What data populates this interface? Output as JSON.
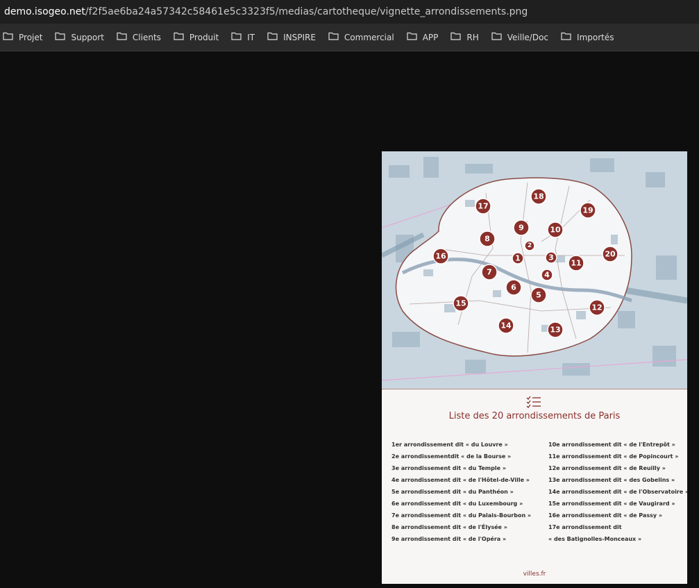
{
  "address_bar": {
    "host": "demo.isogeo.net",
    "path": "/f2f5ae6ba24a57342c58461e5c3323f5/medias/cartotheque/vignette_arrondissements.png"
  },
  "bookmarks": [
    "Projet",
    "Support",
    "Clients",
    "Produit",
    "IT",
    "INSPIRE",
    "Commercial",
    "APP",
    "RH",
    "Veille/Doc",
    "Importés"
  ],
  "image": {
    "title": "Liste des 20 arrondissements de Paris",
    "footer": "villes.fr",
    "map_markers": [
      "1",
      "2",
      "3",
      "4",
      "5",
      "6",
      "7",
      "8",
      "9",
      "10",
      "11",
      "12",
      "13",
      "14",
      "15",
      "16",
      "17",
      "18",
      "19",
      "20"
    ],
    "list_left": [
      "1er arrondissement dit « du Louvre »",
      "2e arrondissementdit « de la Bourse »",
      "3e arrondissement dit « du Temple »",
      "4e arrondissement dit « de l'Hôtel-de-Ville »",
      "5e arrondissement dit « du Panthéon »",
      "6e arrondissement dit « du Luxembourg »",
      "7e arrondissement dit « du Palais-Bourbon »",
      "8e arrondissement dit « de l'Élysée »",
      "9e arrondissement dit « de l'Opéra »"
    ],
    "list_right": [
      "10e arrondissement dit « de l'Entrepôt »",
      "11e arrondissement dit « de Popincourt »",
      "12e arrondissement dit « de Reuilly »",
      "13e arrondissement dit « des Gobelins »",
      "14e arrondissement dit « de l'Observatoire »",
      "15e arrondissement dit « de Vaugirard »",
      "16e arrondissement dit « de Passy »",
      "17e arrondissement dit",
      "« des Batignolles-Monceaux »"
    ]
  },
  "colors": {
    "accent": "#8b2f2a",
    "page_background": "#0e0e0e",
    "map_water": "#c9d6df"
  },
  "icons": {
    "bookmark": "folder-icon",
    "list": "checklist-icon"
  }
}
